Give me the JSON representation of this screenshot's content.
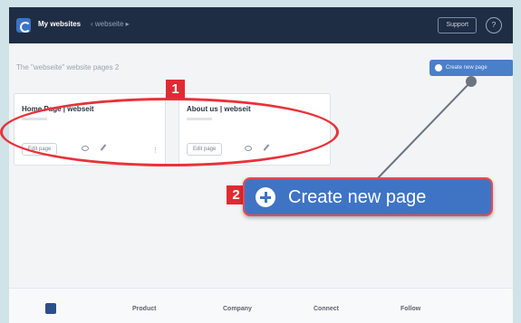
{
  "topbar": {
    "title": "My websites",
    "breadcrumb": "‹ webseite ▸",
    "support_label": "Support",
    "help_label": "?"
  },
  "main": {
    "heading": "The \"webseite\" website pages 2",
    "create_button_label": "Create new page"
  },
  "cards": [
    {
      "title": "Home Page | webseit",
      "edit_label": "Edit page"
    },
    {
      "title": "About us | webseit",
      "edit_label": "Edit page"
    }
  ],
  "callout": {
    "badge_1": "1",
    "badge_2": "2",
    "create_button_label": "Create new page",
    "accent_color": "#e12a33",
    "button_color": "#3f74c4"
  },
  "footer": {
    "links": [
      "Product",
      "Company",
      "Connect",
      "Follow"
    ]
  }
}
